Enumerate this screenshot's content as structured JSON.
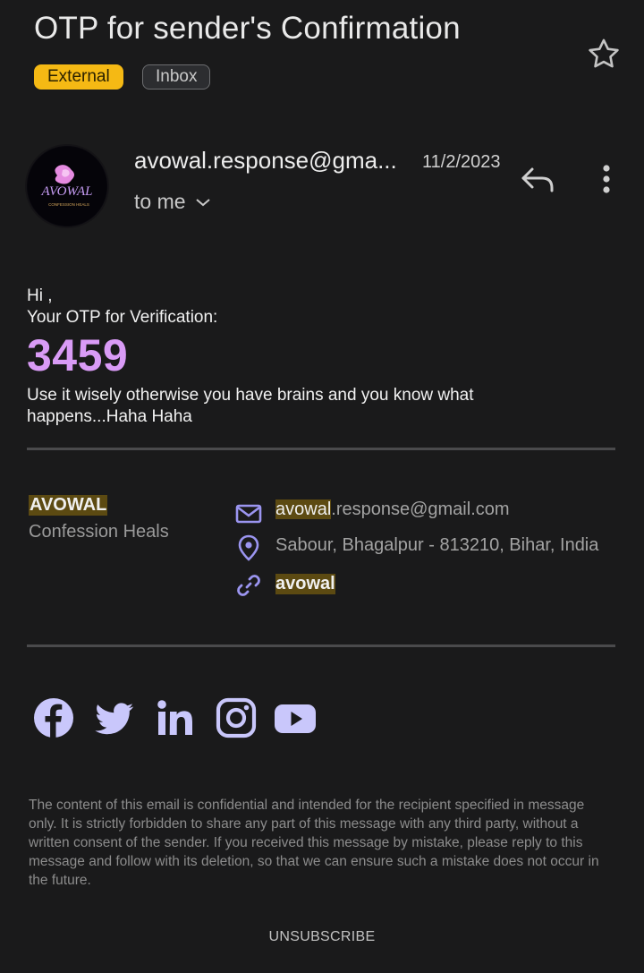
{
  "email": {
    "subject": "OTP for sender's Confirmation",
    "labels": [
      "External",
      "Inbox"
    ],
    "sender": "avowal.response@gma...",
    "date": "11/2/2023",
    "recipient": "to me",
    "avatar_text": "AVOWAL",
    "avatar_subtext": "CONFESSION HEALS"
  },
  "body": {
    "greeting": "Hi ,",
    "otp_label": "Your OTP for Verification:",
    "otp_code": "3459",
    "message": "Use it wisely otherwise you have brains and you know what happens...Haha Haha"
  },
  "signature": {
    "brand": "AVOWAL",
    "tagline": "Confession Heals",
    "email_highlight": "avowal",
    "email_rest": ".response@gmail.com",
    "address": "Sabour, Bhagalpur - 813210, Bihar, India",
    "website": "avowal"
  },
  "social_icons": [
    "facebook-icon",
    "twitter-icon",
    "linkedin-icon",
    "instagram-icon",
    "youtube-icon"
  ],
  "footer": {
    "disclaimer": "The content of this email is confidential and intended for the recipient specified in message only. It is strictly forbidden to share any part of this message with any third party, without a written consent of the sender. If you received this message by mistake, please reply to this message and follow with its deletion, so that we can ensure such a mistake does not occur in the future.",
    "unsubscribe": "UNSUBSCRIBE"
  },
  "colors": {
    "background": "#1a1a1b",
    "external_chip": "#f5b914",
    "otp": "#d99bf6",
    "icon_accent": "#9b95f0",
    "highlight": "#5c4a12"
  }
}
